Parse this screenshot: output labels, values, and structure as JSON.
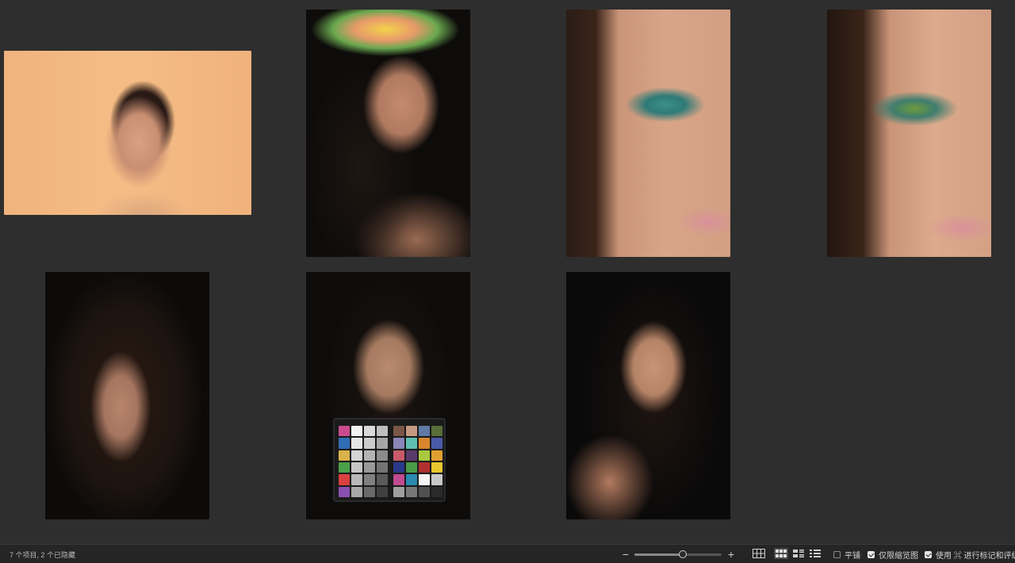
{
  "photos": [
    {
      "id": "p1",
      "icon": "portrait-peach-background"
    },
    {
      "id": "p2",
      "icon": "portrait-flower-crown"
    },
    {
      "id": "p3",
      "icon": "closeup-eye-open"
    },
    {
      "id": "p4",
      "icon": "closeup-eye-closed"
    },
    {
      "id": "p5",
      "icon": "portrait-hair-covering-face"
    },
    {
      "id": "p6",
      "icon": "portrait-color-checker"
    },
    {
      "id": "p7",
      "icon": "portrait-braided-headband"
    }
  ],
  "checker_colors": {
    "left": [
      "#c94b8e",
      "#f2f2f2",
      "#d9d9d9",
      "#bfbfbf",
      "#2f6db5",
      "#e6e6e6",
      "#cccccc",
      "#a6a6a6",
      "#d8b24a",
      "#d4d4d4",
      "#b3b3b3",
      "#8c8c8c",
      "#4aa04a",
      "#c6c6c6",
      "#999999",
      "#737373",
      "#d94040",
      "#b8b8b8",
      "#808080",
      "#5a5a5a",
      "#8a4fb0",
      "#a8a8a8",
      "#6a6a6a",
      "#404040"
    ],
    "right": [
      "#7a5646",
      "#c69a82",
      "#5f7aa6",
      "#5a6e3a",
      "#8a86b8",
      "#5fbfb0",
      "#d98530",
      "#4a5aa8",
      "#c85a6a",
      "#5a3a6a",
      "#a8c840",
      "#e0a030",
      "#2a3a8a",
      "#4a9a4a",
      "#b03030",
      "#e8c830",
      "#c04a90",
      "#2a8ab0",
      "#f4f4f4",
      "#c8c8c8",
      "#a0a0a0",
      "#787878",
      "#505050",
      "#2a2a2a"
    ]
  },
  "statusbar": {
    "count_text": "7 个项目, 2 个已隐藏",
    "zoom_out": "−",
    "zoom_in": "+",
    "zoom_level": 0.55,
    "view_modes": [
      "grid-view-icon",
      "thumbnail-view-icon",
      "list-view-icon",
      "details-view-icon"
    ],
    "active_view": "thumbnail-view-icon",
    "options": [
      {
        "label": "平铺",
        "checked": false
      },
      {
        "label": "仅限缩览图",
        "checked": true
      },
      {
        "label": "使用 ⌘ 进行标记和评级",
        "checked": true
      }
    ]
  }
}
